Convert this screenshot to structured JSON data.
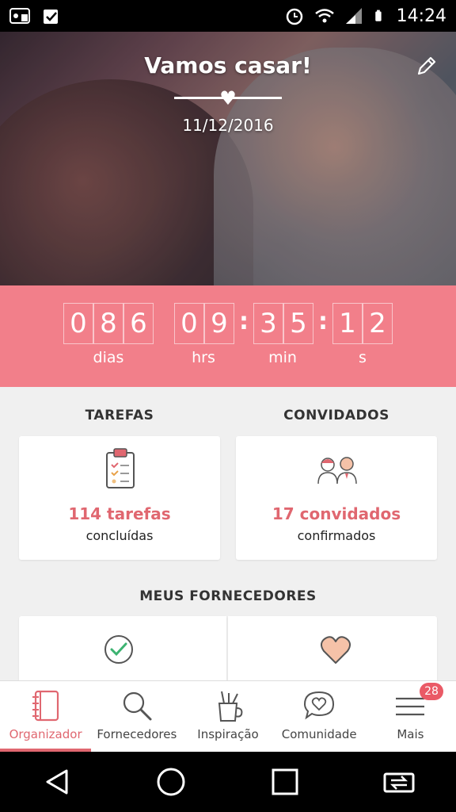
{
  "status_bar": {
    "time": "14:24",
    "icons": [
      "voicemail-icon",
      "task-icon",
      "alarm-icon",
      "wifi-icon",
      "signal-icon",
      "battery-icon"
    ]
  },
  "hero": {
    "title": "Vamos casar!",
    "date": "11/12/2016",
    "edit_icon": "pencil-icon"
  },
  "countdown": {
    "days": [
      "0",
      "8",
      "6"
    ],
    "days_label": "dias",
    "hours": [
      "0",
      "9"
    ],
    "hours_label": "hrs",
    "minutes": [
      "3",
      "5"
    ],
    "minutes_label": "min",
    "seconds": [
      "1",
      "2"
    ],
    "seconds_label": "s",
    "separator": ":"
  },
  "tasks": {
    "title": "TAREFAS",
    "count": "114 tarefas",
    "sub": "concluídas",
    "icon": "clipboard-icon"
  },
  "guests": {
    "title": "CONVIDADOS",
    "count": "17 convidados",
    "sub": "confirmados",
    "icon": "couple-icon"
  },
  "vendors": {
    "title": "MEUS FORNECEDORES",
    "left_icon": "check-circle-icon",
    "right_icon": "heart-icon"
  },
  "bottom_nav": {
    "items": [
      {
        "label": "Organizador",
        "icon": "notebook-icon",
        "active": true
      },
      {
        "label": "Fornecedores",
        "icon": "search-icon"
      },
      {
        "label": "Inspiração",
        "icon": "pencil-cup-icon"
      },
      {
        "label": "Comunidade",
        "icon": "chat-heart-icon"
      },
      {
        "label": "Mais",
        "icon": "menu-icon",
        "badge": "28"
      }
    ]
  },
  "colors": {
    "accent": "#f27f8a",
    "accent_text": "#e06770",
    "badge": "#ea5a66"
  }
}
